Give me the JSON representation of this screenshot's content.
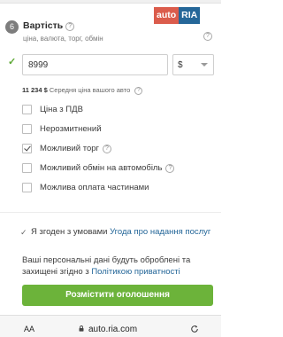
{
  "section": {
    "step": "6",
    "title": "Вартість",
    "subtitle": "ціна, валюта, торг, обмін"
  },
  "logo": {
    "part1": "auto",
    "part2": "RIA"
  },
  "price": {
    "value": "8999",
    "currency": "$",
    "average_amount": "11 234 $",
    "average_label": "Середня ціна вашого авто"
  },
  "options": [
    {
      "label": "Ціна з ПДВ",
      "checked": false,
      "help": false
    },
    {
      "label": "Нерозмитнений",
      "checked": false,
      "help": false
    },
    {
      "label": "Можливий торг",
      "checked": true,
      "help": true
    },
    {
      "label": "Можливий обмін на автомобіль",
      "checked": false,
      "help": true
    },
    {
      "label": "Можлива оплата частинами",
      "checked": false,
      "help": false
    }
  ],
  "consent": {
    "prefix": "Я згоден з умовами ",
    "link": "Угода про надання послуг"
  },
  "privacy": {
    "prefix": "Ваші персональні дані будуть оброблені та захищені згідно з ",
    "link": "Політикою приватності"
  },
  "publish_label": "Розмістити оголошення",
  "browser": {
    "aa": "AA",
    "url": "auto.ria.com"
  },
  "colors": {
    "accent": "#6cb33a",
    "link": "#256799",
    "brand_red": "#db5c4c"
  },
  "icons": [
    "help-icon",
    "check-icon",
    "chevron-down-icon",
    "lock-icon",
    "reload-icon"
  ]
}
